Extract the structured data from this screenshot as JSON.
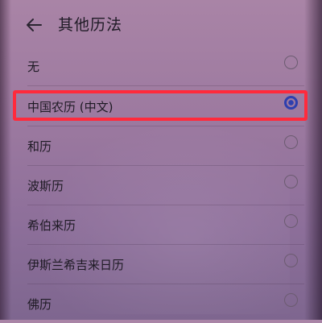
{
  "header": {
    "title": "其他历法"
  },
  "calendars": [
    {
      "label": "无",
      "selected": false
    },
    {
      "label": "中国农历 (中文)",
      "selected": true
    },
    {
      "label": "和历",
      "selected": false
    },
    {
      "label": "波斯历",
      "selected": false
    },
    {
      "label": "希伯来历",
      "selected": false
    },
    {
      "label": "伊斯兰希吉来日历",
      "selected": false
    },
    {
      "label": "佛历",
      "selected": false
    }
  ],
  "colors": {
    "highlight": "#ff2a3c",
    "radio_selected": "#2e3fae"
  },
  "icons": {
    "back": "back-arrow-icon"
  }
}
